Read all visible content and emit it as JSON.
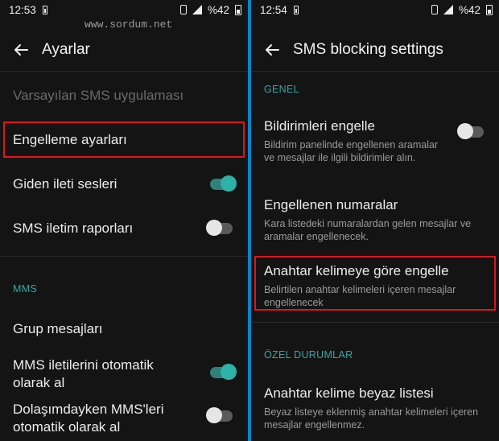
{
  "watermark": "www.sordum.net",
  "left": {
    "status": {
      "time": "12:53",
      "battery": "%42"
    },
    "title": "Ayarlar",
    "items": {
      "default_sms": "Varsayılan SMS uygulaması",
      "block_settings": "Engelleme ayarları",
      "outgoing_sounds": "Giden ileti sesleri",
      "delivery_reports": "SMS iletim raporları"
    },
    "mms_section": "MMS",
    "mms_items": {
      "group": "Grup mesajları",
      "auto_retrieve_1": "MMS iletilerini otomatik",
      "auto_retrieve_2": "olarak al",
      "roaming_1": "Dolaşımdayken MMS'leri",
      "roaming_2": "otomatik olarak al"
    },
    "toggles": {
      "outgoing_sounds": true,
      "delivery_reports": false,
      "auto_retrieve": true,
      "roaming": false
    }
  },
  "right": {
    "status": {
      "time": "12:54",
      "battery": "%42"
    },
    "title": "SMS blocking settings",
    "general_section": "GENEL",
    "items": {
      "block_notif_title": "Bildirimleri engelle",
      "block_notif_sub": "Bildirim panelinde engellenen aramalar ve mesajlar ile ilgili bildirimler alın.",
      "blocked_numbers_title": "Engellenen numaralar",
      "blocked_numbers_sub": "Kara listedeki numaralardan gelen mesajlar ve aramalar engellenecek.",
      "keyword_block_title": "Anahtar kelimeye göre engelle",
      "keyword_block_sub": "Belirtilen anahtar kelimeleri içeren mesajlar engellenecek"
    },
    "special_section": "ÖZEL DURUMLAR",
    "special_items": {
      "whitelist_title": "Anahtar kelime beyaz listesi",
      "whitelist_sub": "Beyaz listeye eklenmiş anahtar kelimeleri içeren mesajlar engellenmez."
    },
    "toggles": {
      "block_notif": false
    }
  },
  "colors": {
    "accent": "#2eb2a8",
    "highlight": "#e0141e",
    "divider": "#0a84c6"
  }
}
